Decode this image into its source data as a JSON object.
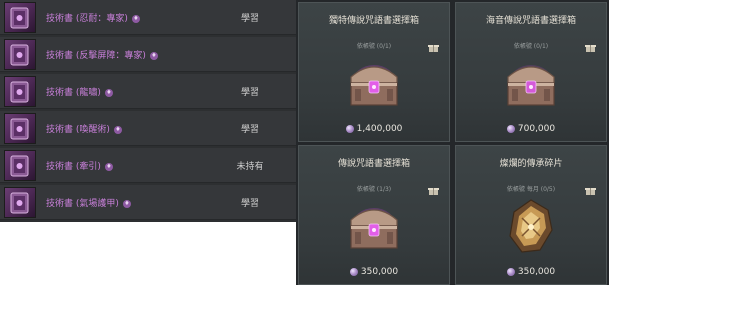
{
  "skill_books": [
    {
      "name": "技術書 (忍耐：專家)",
      "state": "學習",
      "icon": "skill-book-icon"
    },
    {
      "name": "技術書 (反擊屏障：專家)",
      "state": "",
      "icon": "skill-book-icon"
    },
    {
      "name": "技術書 (龍嘯)",
      "state": "學習",
      "icon": "skill-book-icon"
    },
    {
      "name": "技術書 (喚醒術)",
      "state": "學習",
      "icon": "skill-book-icon"
    },
    {
      "name": "技術書 (牽引)",
      "state": "未持有",
      "icon": "skill-book-icon"
    },
    {
      "name": "技術書 (氣場護甲)",
      "state": "學習",
      "icon": "skill-book-icon"
    }
  ],
  "shop_items": [
    {
      "title": "獨特傳說咒語書選擇箱",
      "sub": "依帳號 (0/1)",
      "price": "1,400,000",
      "icon": "chest-icon"
    },
    {
      "title": "海音傳說咒語書選擇箱",
      "sub": "依帳號 (0/1)",
      "price": "700,000",
      "icon": "chest-icon"
    },
    {
      "title": "傳說咒語書選擇箱",
      "sub": "依帳號 (1/3)",
      "price": "350,000",
      "icon": "chest-icon"
    },
    {
      "title": "燦爛的傳承碎片",
      "sub": "依帳號 每月 (0/5)",
      "price": "350,000",
      "icon": "shard-icon"
    }
  ],
  "colors": {
    "skill_name": "#c77fd8",
    "card_bg": "#3d4446",
    "list_bg": "#35373a"
  }
}
